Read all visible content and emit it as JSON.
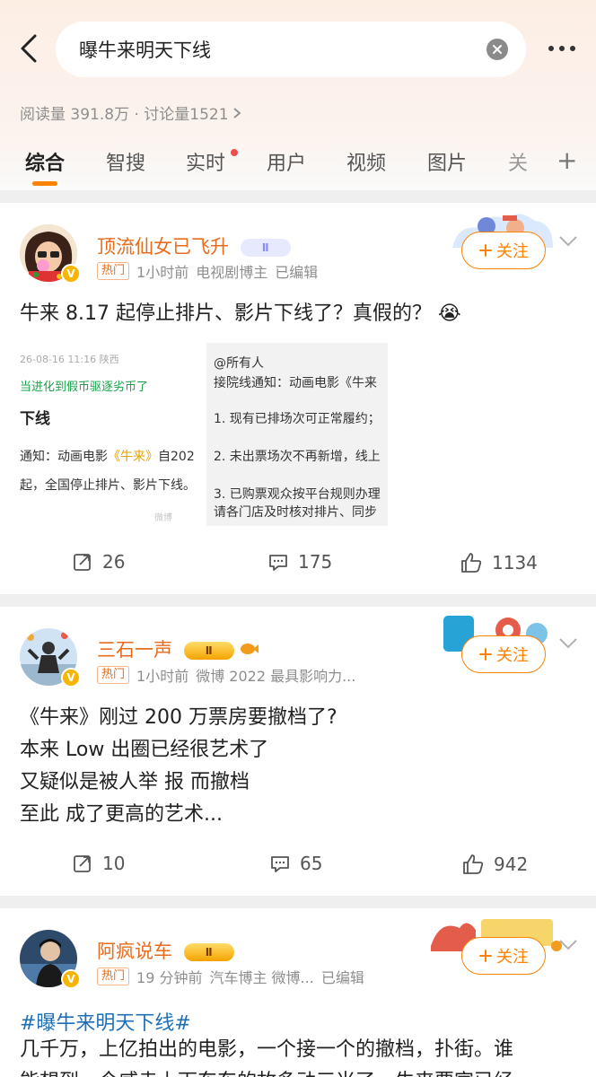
{
  "header": {
    "search_query": "曝牛来明天下线",
    "stats": "阅读量 391.8万 · 讨论量1521",
    "tabs": [
      "综合",
      "智搜",
      "实时",
      "用户",
      "视频",
      "图片",
      "关"
    ],
    "active_tab": "综合"
  },
  "posts": [
    {
      "user": "顶流仙女已飞升",
      "level_badge": "Ⅱ",
      "hot": "热门",
      "time": "1小时前",
      "tag": "电视剧博主",
      "edited": "已编辑",
      "follow": "关注",
      "text": "牛来 8.17 起停止排片、影片下线了？真假的？",
      "emoji": "😭",
      "image_left": {
        "date": "26-08-16 11:16 陕西",
        "green_line": "当进化到假币驱逐劣币了",
        "title": "下线",
        "line1_a": "通知：动画电影",
        "line1_film": "《牛来》",
        "line1_b": "自202",
        "line2": "起，全国停止排片、影片下线。",
        "watermark": "微博"
      },
      "image_right": {
        "line1": "@所有人",
        "line2": "接院线通知：动画电影《牛来",
        "line3": "1. 现有已排场次可正常履约；",
        "line4": "2. 未出票场次不再新增，线上",
        "line5": "3. 已购票观众按平台规则办理",
        "line6": "请各门店及时核对排片、同步"
      },
      "reposts": "26",
      "comments": "175",
      "likes": "1134"
    },
    {
      "user": "三石一声",
      "level_badge": "Ⅱ",
      "hot": "热门",
      "time": "1小时前",
      "tag": "微博 2022 最具影响力...",
      "follow": "关注",
      "lines": [
        "《牛来》刚过 200 万票房要撤档了?",
        "本来 Low 出圈已经很艺术了",
        "又疑似是被人举 报 而撤档",
        "至此 成了更高的艺术..."
      ],
      "reposts": "10",
      "comments": "65",
      "likes": "942"
    },
    {
      "user": "阿疯说车",
      "level_badge": "Ⅱ",
      "hot": "热门",
      "time": "19 分钟前",
      "tag": "汽车博主 微博...",
      "edited": "已编辑",
      "follow": "关注",
      "hashtag": "#曝牛来明天下线#",
      "line1": "几千万，上亿拍出的电影，一个接一个的撤档，扑街。谁",
      "line2": "能想到，今威走上下东东的故多动三米了，牛来要宣已经"
    }
  ],
  "colors": {
    "accent": "#ff8200",
    "username": "#e86b1e",
    "link": "#1f6fb6"
  }
}
